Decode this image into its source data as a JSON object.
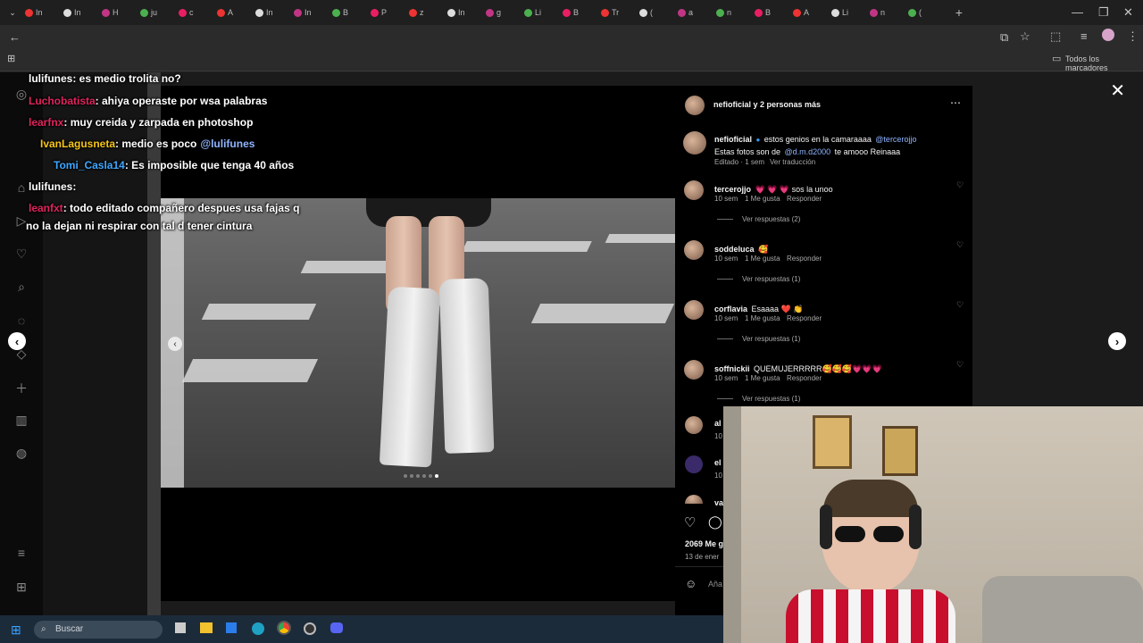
{
  "browser": {
    "tab_count_labels": [
      "In",
      "In",
      "H",
      "ju",
      "c",
      "A",
      "In",
      "In",
      "B",
      "P",
      "z",
      "In",
      "g",
      "Li",
      "B",
      "Tr",
      "(",
      "a",
      "n",
      "B",
      "A",
      "Li",
      "n",
      "("
    ],
    "new_tab": "+",
    "bookmarks_label": "Todos los marcadores"
  },
  "chat": [
    {
      "user": "lulifunes",
      "color": "#ffffff",
      "text": ": es medio trolita no?"
    },
    {
      "user": "Luchobatista",
      "color": "#e0245e",
      "text": ": ahiya operaste por wsa palabras"
    },
    {
      "user": "learfnx",
      "color": "#e0245e",
      "text": ": muy creida y zarpada en photoshop"
    },
    {
      "user": "IvanLagusneta",
      "color": "#f5c518",
      "text": ": medio es poco",
      "mention": "@lulifunes"
    },
    {
      "user": "Tomi_Casla14",
      "color": "#3ea6ff",
      "text": ": Es imposible que tenga 40 años"
    },
    {
      "user": "lulifunes",
      "color": "#ffffff",
      "text": ":"
    },
    {
      "user": "leanfxt",
      "color": "#e0245e",
      "text": ": todo editado compañero despues usa fajas q"
    },
    {
      "user": "",
      "color": "#ffffff",
      "text": "no la dejan ni respirar con tal d tener cintura"
    }
  ],
  "post": {
    "header_user": "nefioficial y 2 personas más",
    "caption_user": "nefioficial",
    "caption_text": "estos genios en la camaraaaa",
    "caption_mention": "@tercerojjo",
    "caption_line2a": "Estas fotos son de",
    "caption_mention2": "@d.m.d2000",
    "caption_line2b": "te amooo Reinaaa",
    "caption_meta": "Editado · 1 sem",
    "translate": "Ver traducción",
    "likes": "2069 Me g",
    "date": "13 de ener",
    "add_comment": "Aña"
  },
  "comments": [
    {
      "user": "tercerojjo",
      "text": "💗 💗 💗 sos la unoo",
      "time": "10 sem",
      "likes": "1 Me gusta",
      "reply": "Responder",
      "replies": "Ver respuestas (2)"
    },
    {
      "user": "soddeluca",
      "text": "🥰",
      "time": "10 sem",
      "likes": "1 Me gusta",
      "reply": "Responder",
      "replies": "Ver respuestas (1)"
    },
    {
      "user": "corflavia",
      "text": "Esaaaa ❤️ 👏",
      "time": "10 sem",
      "likes": "1 Me gusta",
      "reply": "Responder",
      "replies": "Ver respuestas (1)"
    },
    {
      "user": "soffnickii",
      "text": "QUEMUJERRRRR🥰🥰🥰💗💗💗",
      "time": "10 sem",
      "likes": "1 Me gusta",
      "reply": "Responder",
      "replies": "Ver respuestas (1)"
    }
  ],
  "partial_users": [
    "al",
    "el",
    "va"
  ],
  "partial_meta": [
    "10",
    "10"
  ],
  "taskbar": {
    "search_placeholder": "Buscar"
  },
  "icons": {
    "sidebar": [
      "instagram-icon",
      "home-icon",
      "reels-icon",
      "heart-icon",
      "search-icon",
      "explore-icon",
      "messages-icon",
      "create-icon",
      "dashboard-icon",
      "avatar-icon",
      "menu-icon",
      "apps-icon"
    ]
  }
}
